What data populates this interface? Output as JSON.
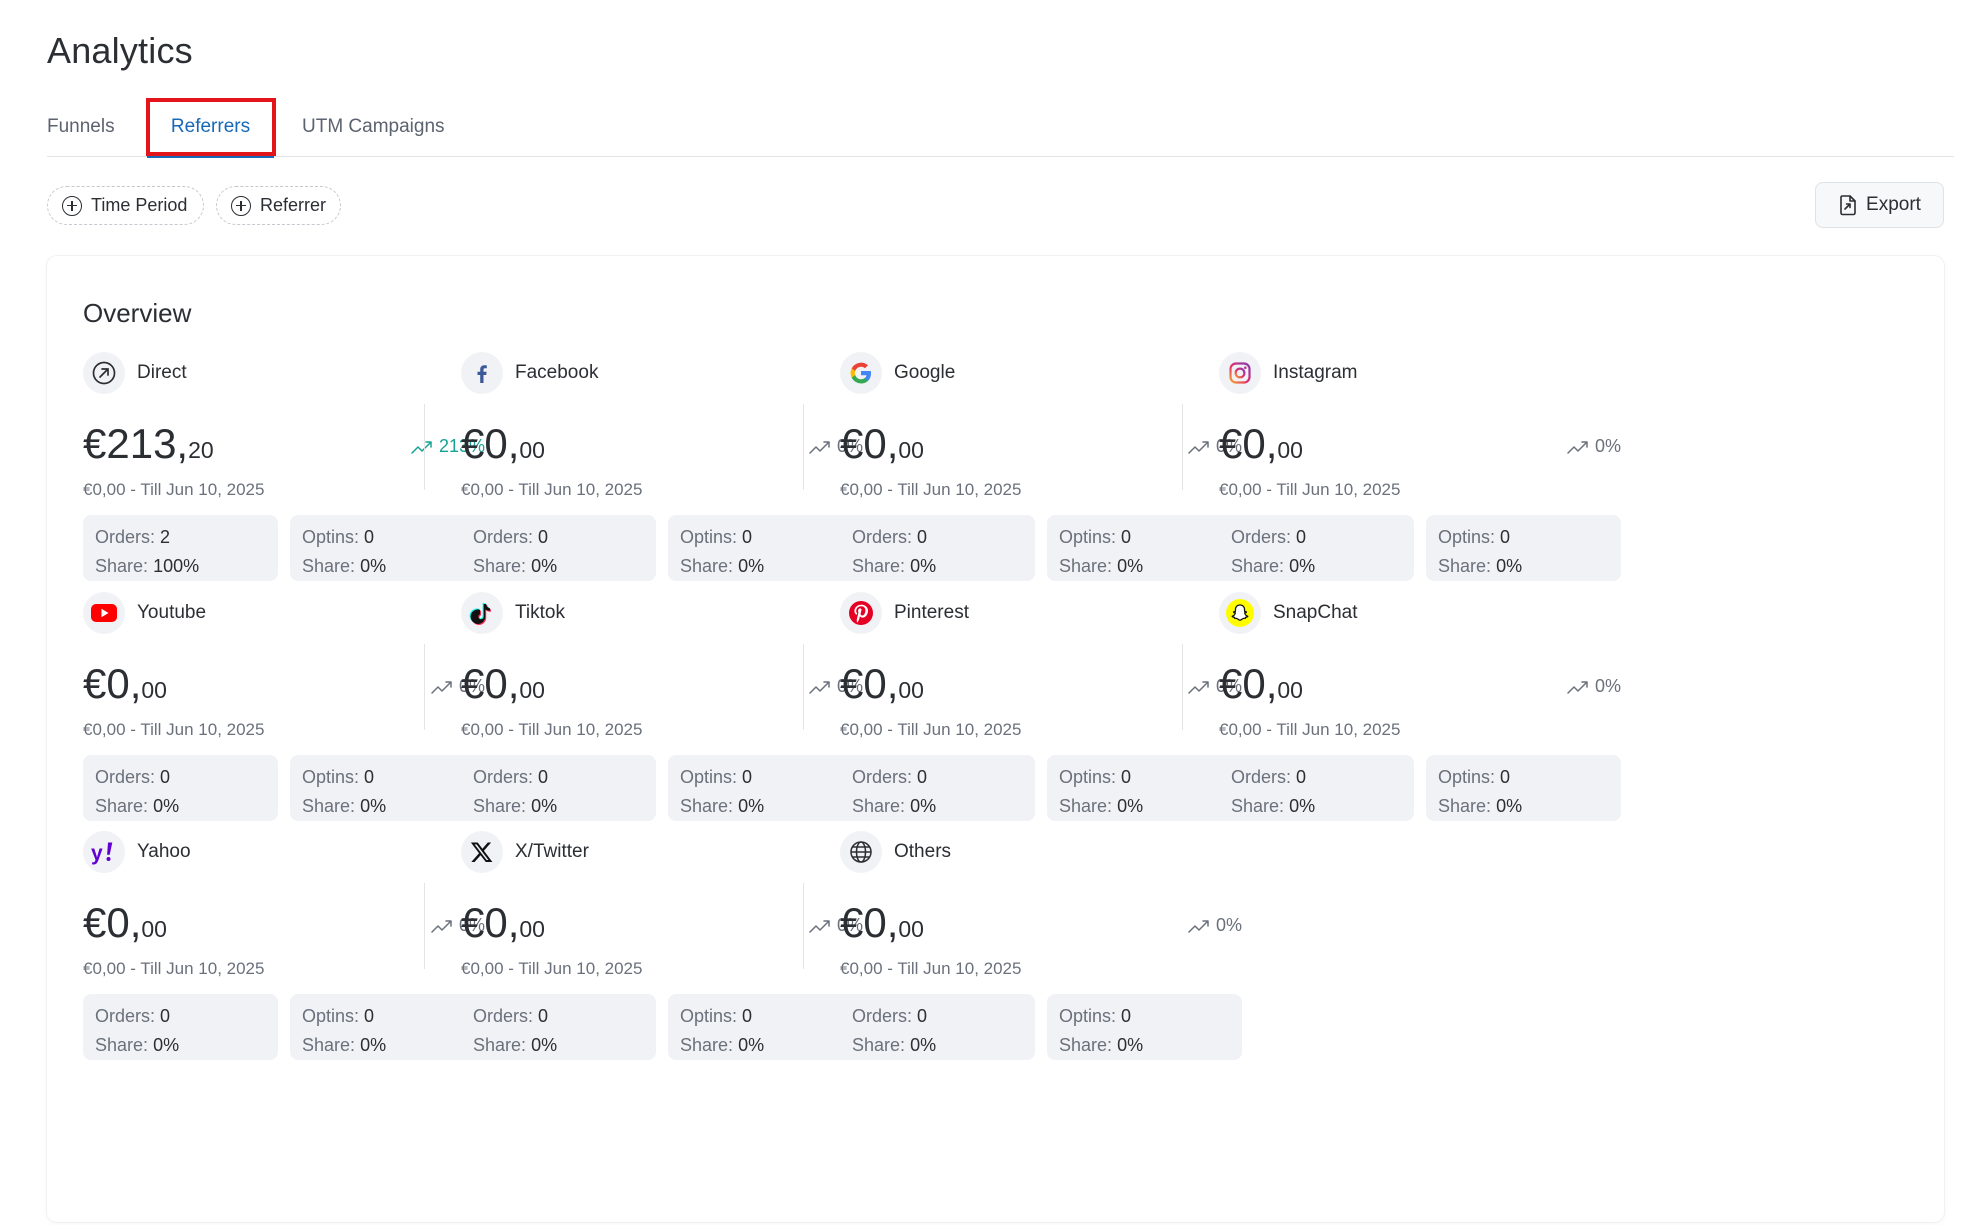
{
  "page": {
    "title": "Analytics"
  },
  "tabs": [
    {
      "label": "Funnels"
    },
    {
      "label": "Referrers",
      "active": true
    },
    {
      "label": "UTM Campaigns"
    }
  ],
  "filters": [
    {
      "label": "Time Period",
      "icon": "plus-circle-icon"
    },
    {
      "label": "Referrer",
      "icon": "plus-circle-icon"
    }
  ],
  "export": {
    "label": "Export",
    "icon": "export-file-icon"
  },
  "overview": {
    "title": "Overview",
    "labels": {
      "orders": "Orders:",
      "optins": "Optins:",
      "share": "Share:"
    },
    "cards": [
      {
        "name": "Direct",
        "icon": "direct-arrow-icon",
        "amount_main": "€213,",
        "amount_cents": "20",
        "trend": "213%",
        "trend_up": true,
        "period": "€0,00 - Till Jun 10, 2025",
        "orders": "2",
        "orders_share": "100%",
        "optins": "0",
        "optins_share": "0%"
      },
      {
        "name": "Facebook",
        "icon": "facebook-icon",
        "amount_main": "€0,",
        "amount_cents": "00",
        "trend": "0%",
        "trend_up": false,
        "period": "€0,00 - Till Jun 10, 2025",
        "orders": "0",
        "orders_share": "0%",
        "optins": "0",
        "optins_share": "0%"
      },
      {
        "name": "Google",
        "icon": "google-icon",
        "amount_main": "€0,",
        "amount_cents": "00",
        "trend": "0%",
        "trend_up": false,
        "period": "€0,00 - Till Jun 10, 2025",
        "orders": "0",
        "orders_share": "0%",
        "optins": "0",
        "optins_share": "0%"
      },
      {
        "name": "Instagram",
        "icon": "instagram-icon",
        "amount_main": "€0,",
        "amount_cents": "00",
        "trend": "0%",
        "trend_up": false,
        "period": "€0,00 - Till Jun 10, 2025",
        "orders": "0",
        "orders_share": "0%",
        "optins": "0",
        "optins_share": "0%"
      },
      {
        "name": "Youtube",
        "icon": "youtube-icon",
        "amount_main": "€0,",
        "amount_cents": "00",
        "trend": "0%",
        "trend_up": false,
        "period": "€0,00 - Till Jun 10, 2025",
        "orders": "0",
        "orders_share": "0%",
        "optins": "0",
        "optins_share": "0%"
      },
      {
        "name": "Tiktok",
        "icon": "tiktok-icon",
        "amount_main": "€0,",
        "amount_cents": "00",
        "trend": "0%",
        "trend_up": false,
        "period": "€0,00 - Till Jun 10, 2025",
        "orders": "0",
        "orders_share": "0%",
        "optins": "0",
        "optins_share": "0%"
      },
      {
        "name": "Pinterest",
        "icon": "pinterest-icon",
        "amount_main": "€0,",
        "amount_cents": "00",
        "trend": "0%",
        "trend_up": false,
        "period": "€0,00 - Till Jun 10, 2025",
        "orders": "0",
        "orders_share": "0%",
        "optins": "0",
        "optins_share": "0%"
      },
      {
        "name": "SnapChat",
        "icon": "snapchat-icon",
        "amount_main": "€0,",
        "amount_cents": "00",
        "trend": "0%",
        "trend_up": false,
        "period": "€0,00 - Till Jun 10, 2025",
        "orders": "0",
        "orders_share": "0%",
        "optins": "0",
        "optins_share": "0%"
      },
      {
        "name": "Yahoo",
        "icon": "yahoo-icon",
        "amount_main": "€0,",
        "amount_cents": "00",
        "trend": "0%",
        "trend_up": false,
        "period": "€0,00 - Till Jun 10, 2025",
        "orders": "0",
        "orders_share": "0%",
        "optins": "0",
        "optins_share": "0%"
      },
      {
        "name": "X/Twitter",
        "icon": "x-twitter-icon",
        "amount_main": "€0,",
        "amount_cents": "00",
        "trend": "0%",
        "trend_up": false,
        "period": "€0,00 - Till Jun 10, 2025",
        "orders": "0",
        "orders_share": "0%",
        "optins": "0",
        "optins_share": "0%"
      },
      {
        "name": "Others",
        "icon": "globe-icon",
        "amount_main": "€0,",
        "amount_cents": "00",
        "trend": "0%",
        "trend_up": false,
        "period": "€0,00 - Till Jun 10, 2025",
        "orders": "0",
        "orders_share": "0%",
        "optins": "0",
        "optins_share": "0%"
      }
    ]
  },
  "colors": {
    "accent": "#1868b7",
    "trend_up": "#15a394",
    "tab_highlight": "#e4141b"
  }
}
